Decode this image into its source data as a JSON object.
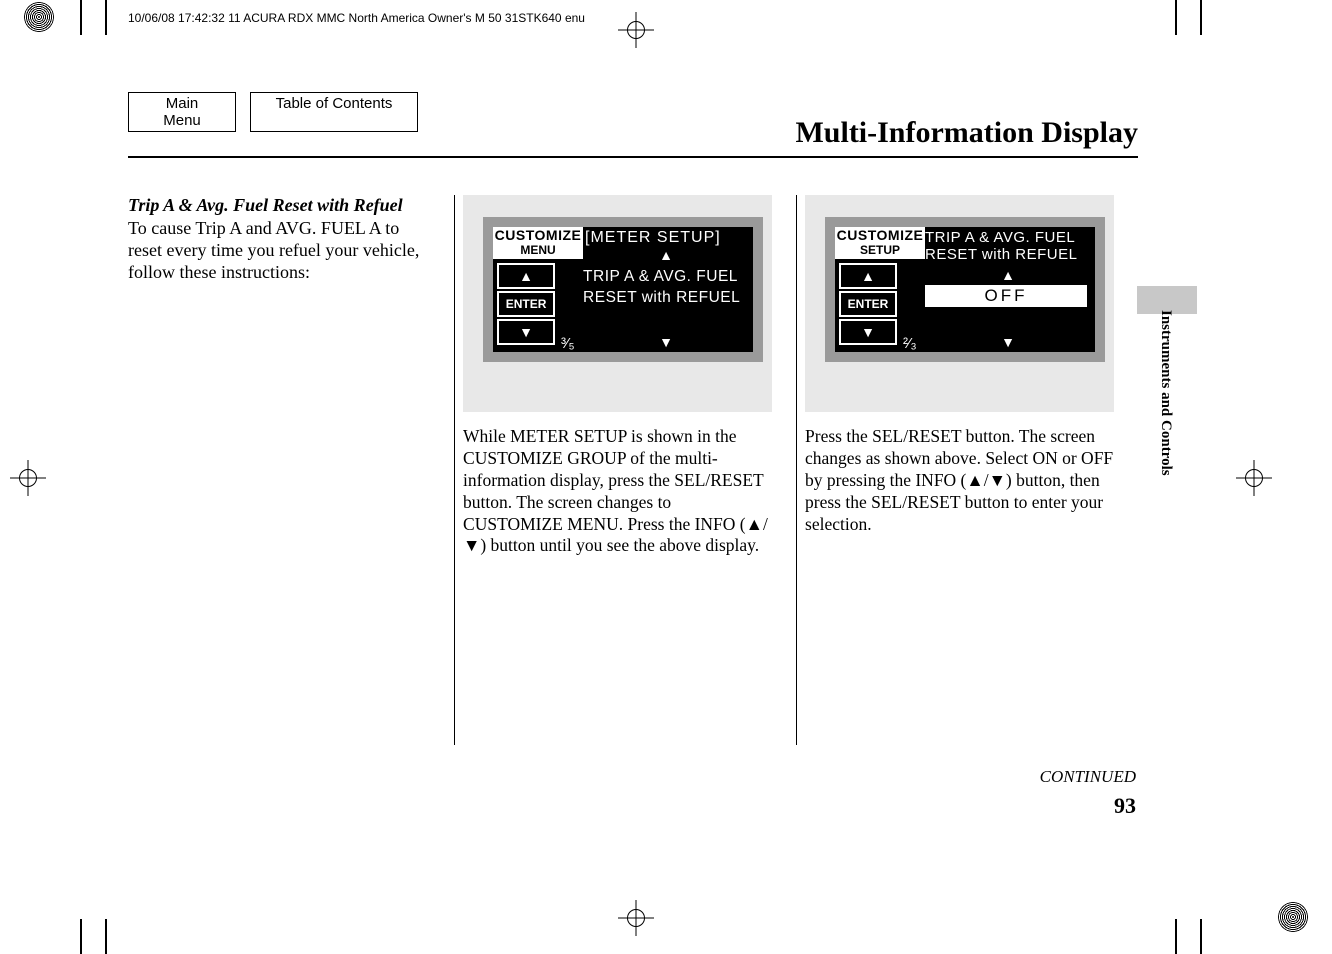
{
  "header_line": "10/06/08 17:42:32    11 ACURA RDX MMC North America Owner's M 50 31STK640 enu",
  "nav": {
    "main_menu": "Main Menu",
    "toc": "Table of Contents"
  },
  "page_title": "Multi-Information Display",
  "side_tab": "Instruments and Controls",
  "col1": {
    "subhead": "Trip A & Avg. Fuel Reset with Refuel",
    "body": "To cause Trip A and AVG. FUEL A to reset every time you refuel your vehicle, follow these instructions:"
  },
  "col2": {
    "screen": {
      "top_label": "CUSTOMIZE",
      "sub_label": "MENU",
      "btn_up": "▲",
      "btn_enter": "ENTER",
      "btn_down": "▼",
      "title": "[METER SETUP]",
      "line1": "TRIP A & AVG. FUEL",
      "line2": "RESET with REFUEL",
      "arrow_up": "▲",
      "arrow_down": "▼",
      "page_ind": "³⁄₅"
    },
    "body": "While METER SETUP is shown in the CUSTOMIZE GROUP of the multi-information display, press the SEL/RESET button. The screen changes to CUSTOMIZE MENU. Press the INFO (▲/▼) button until you see the above display."
  },
  "col3": {
    "screen": {
      "top_label": "CUSTOMIZE",
      "sub_label": "SETUP",
      "btn_up": "▲",
      "btn_enter": "ENTER",
      "btn_down": "▼",
      "title_a": "TRIP A & AVG. FUEL",
      "title_b": "RESET with REFUEL",
      "arrow_up": "▲",
      "value": "OFF",
      "arrow_down": "▼",
      "page_ind": "²⁄₃"
    },
    "body": "Press the SEL/RESET button. The screen changes as shown above. Select ON or OFF by pressing the INFO (▲/▼) button, then press the SEL/RESET button to enter your selection."
  },
  "continued": "CONTINUED",
  "page_number": "93"
}
